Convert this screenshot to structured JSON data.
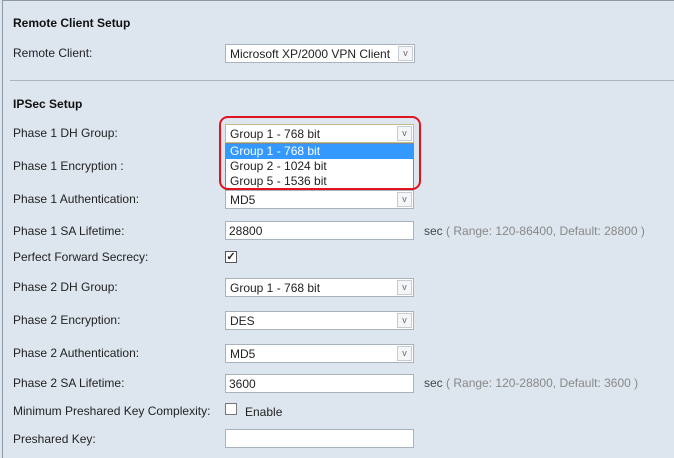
{
  "remote_client_setup": {
    "title": "Remote Client Setup",
    "remote_client_label": "Remote Client:",
    "remote_client_value": "Microsoft XP/2000 VPN Client"
  },
  "ipsec_setup": {
    "title": "IPSec Setup",
    "phase1_dh_label": "Phase 1 DH Group:",
    "phase1_dh_value": "Group 1 - 768 bit",
    "phase1_dh_options": [
      "Group 1 - 768 bit",
      "Group 2 - 1024 bit",
      "Group 5 - 1536 bit"
    ],
    "phase1_enc_label": "Phase 1 Encryption :",
    "phase1_auth_label": "Phase 1 Authentication:",
    "phase1_auth_value": "MD5",
    "phase1_sa_label": "Phase 1 SA Lifetime:",
    "phase1_sa_value": "28800",
    "phase1_sa_unit": "sec",
    "phase1_sa_hint": "( Range: 120-86400, Default: 28800 )",
    "pfs_label": "Perfect Forward Secrecy:",
    "pfs_checked": true,
    "phase2_dh_label": "Phase 2 DH Group:",
    "phase2_dh_value": "Group 1 - 768 bit",
    "phase2_enc_label": "Phase 2 Encryption:",
    "phase2_enc_value": "DES",
    "phase2_auth_label": "Phase 2 Authentication:",
    "phase2_auth_value": "MD5",
    "phase2_sa_label": "Phase 2 SA Lifetime:",
    "phase2_sa_value": "3600",
    "phase2_sa_unit": "sec",
    "phase2_sa_hint": "( Range: 120-28800, Default: 3600 )",
    "min_psk_label": "Minimum Preshared Key Complexity:",
    "min_psk_enable": "Enable",
    "min_psk_checked": false,
    "psk_label": "Preshared Key:",
    "psk_value": ""
  },
  "icons": {
    "dropdown": "chevron-down-icon",
    "check": "checkmark-icon"
  },
  "colors": {
    "highlight": "#e0141e",
    "selected_option": "#3399ff"
  }
}
